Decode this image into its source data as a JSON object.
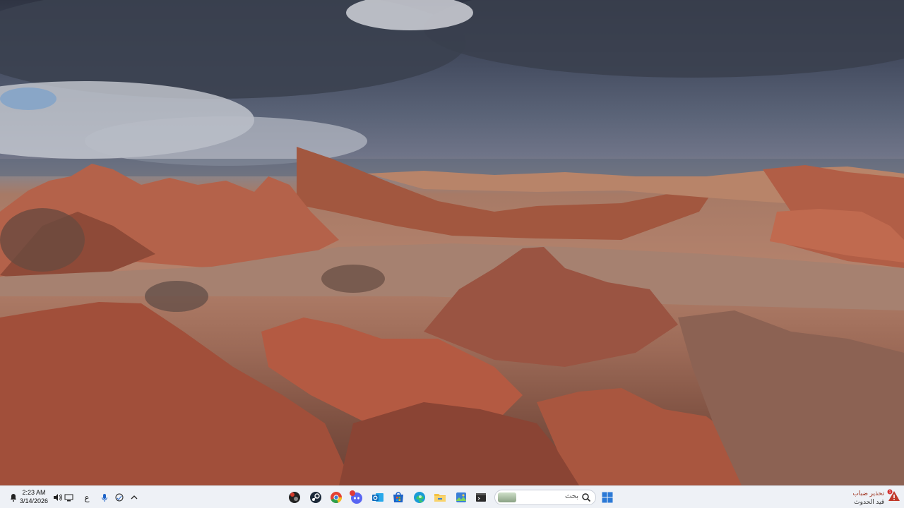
{
  "wallpaper": {
    "description_icon": "desert-landscape-wallpaper",
    "colors": {
      "sky_dark": "#2f3443",
      "sky_light": "#c9ced6",
      "rock": "#b4624a",
      "sand": "#9c7a68"
    }
  },
  "taskbar": {
    "clock": {
      "time": "2:23 AM",
      "date": "3/14/2026"
    },
    "tray": [
      {
        "icon": "notification-icon"
      },
      {
        "icon": "volume-icon"
      },
      {
        "icon": "network-icon"
      },
      {
        "icon": "language-icon",
        "label": "ع"
      },
      {
        "icon": "microphone-icon"
      },
      {
        "icon": "copilot-icon"
      },
      {
        "icon": "chevron-up-icon"
      }
    ],
    "apps": [
      {
        "name": "app-icon-black-red",
        "color": "#222222",
        "accent": "#d33a2c"
      },
      {
        "name": "steam-icon",
        "color": "#1b2838"
      },
      {
        "name": "chrome-icon",
        "color": "#e34133"
      },
      {
        "name": "discord-icon",
        "color": "#5865f2",
        "badge": "99+"
      },
      {
        "name": "outlook-icon",
        "color": "#0f6cbd"
      },
      {
        "name": "windows-store-icon",
        "color": "#1d63c8"
      },
      {
        "name": "edge-icon",
        "color": "#1a9bd7"
      },
      {
        "name": "file-explorer-icon",
        "color": "#f5c242"
      },
      {
        "name": "photos-icon",
        "color": "#3b7fd6"
      },
      {
        "name": "terminal-icon",
        "color": "#2b2b2b"
      }
    ],
    "search": {
      "placeholder": "بحث"
    },
    "start": {
      "icon": "windows-start-icon",
      "color": "#2b79d6"
    },
    "weather": {
      "title": "تحذير ضباب",
      "subtitle": "قيد الحدوث",
      "icon": "warning-icon",
      "badge": "1"
    }
  }
}
